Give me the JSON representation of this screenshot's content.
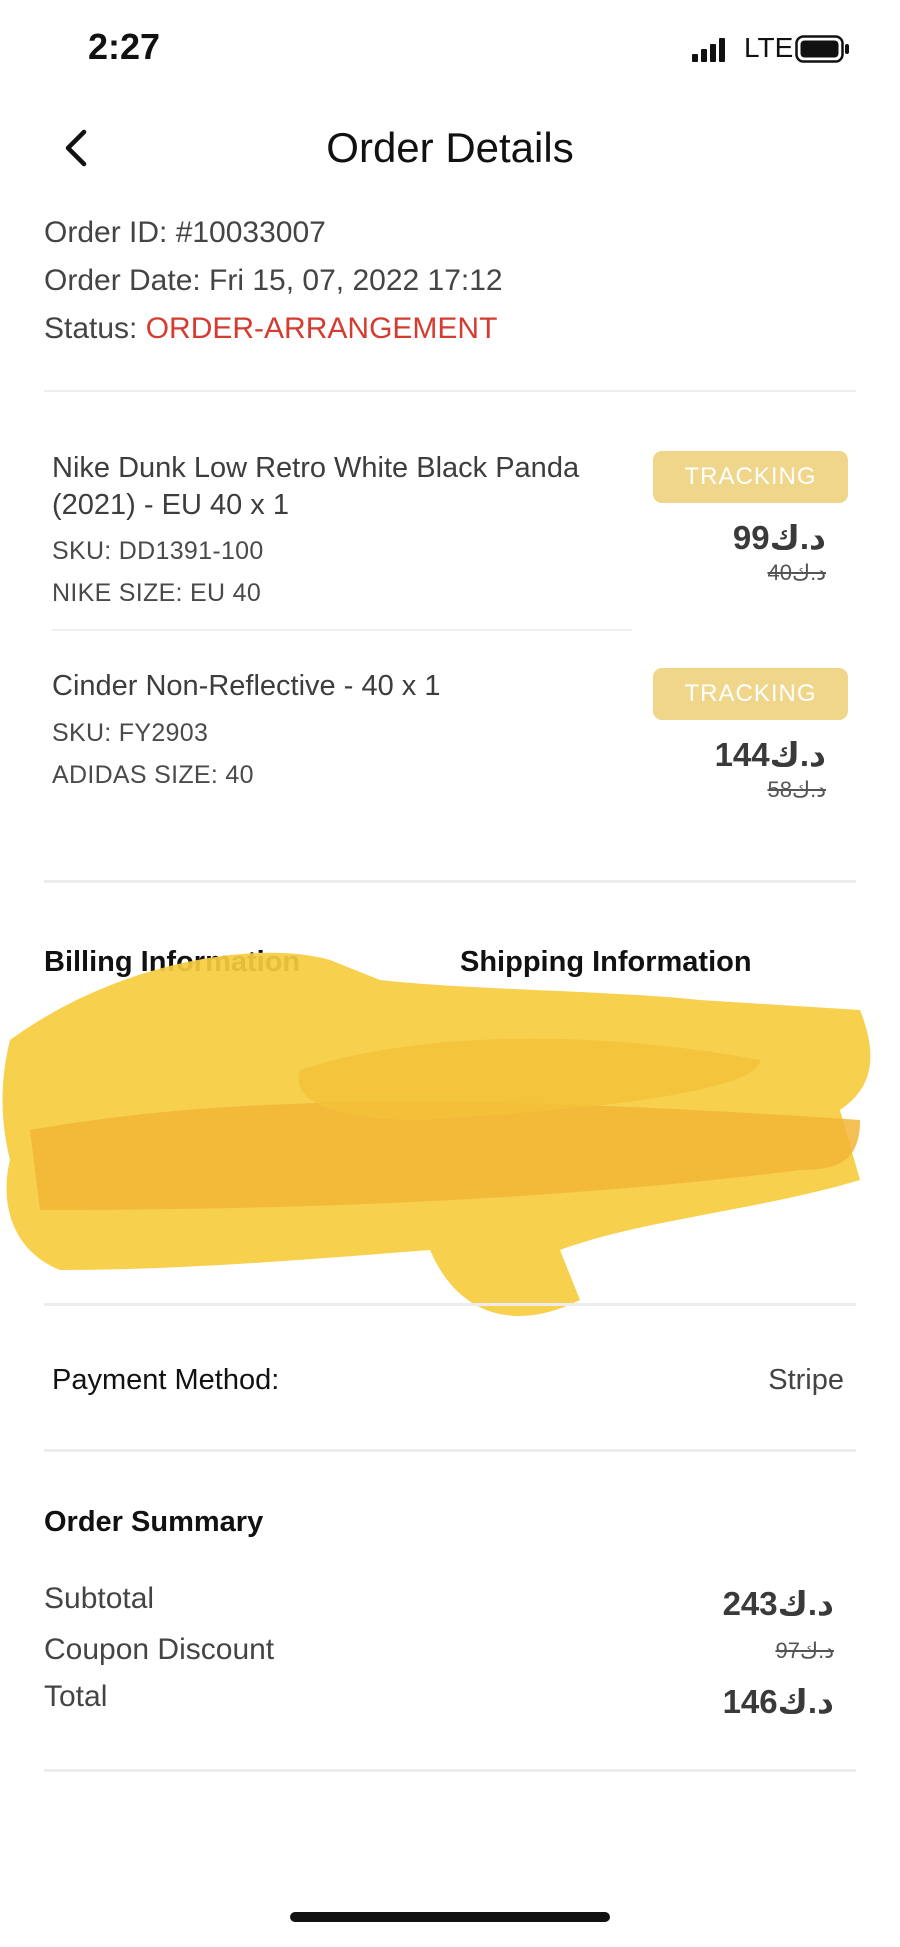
{
  "status_bar": {
    "time": "2:27",
    "network": "LTE"
  },
  "header": {
    "title": "Order Details"
  },
  "order": {
    "id_label": "Order ID: #10033007",
    "date_label": "Order Date: Fri 15, 07, 2022 17:12",
    "status_prefix": "Status: ",
    "status_value": "ORDER-ARRANGEMENT",
    "status_color": "#d63b2f"
  },
  "items": [
    {
      "name": "Nike Dunk Low Retro White Black Panda (2021) - EU 40 x 1",
      "sku": "SKU: DD1391-100",
      "size": "NIKE SIZE: EU 40",
      "button": "TRACKING",
      "price": "99د.ك",
      "old_price": "40د.ك"
    },
    {
      "name": "Cinder Non-Reflective - 40 x 1",
      "sku": "SKU: FY2903",
      "size": "ADIDAS SIZE: 40",
      "button": "TRACKING",
      "price": "144د.ك",
      "old_price": "58د.ك"
    }
  ],
  "billing": {
    "title": "Billing Information"
  },
  "shipping": {
    "title": "Shipping Information"
  },
  "payment": {
    "label": "Payment Method:",
    "value": "Stripe"
  },
  "summary": {
    "title": "Order Summary",
    "subtotal_label": "Subtotal",
    "subtotal_value": "243د.ك",
    "coupon_label": "Coupon Discount",
    "coupon_value": "97د.ك",
    "total_label": "Total",
    "total_value": "146د.ك"
  },
  "colors": {
    "accent_button": "#f0d68b",
    "status": "#d63b2f",
    "scribble": "#f5c93a"
  }
}
